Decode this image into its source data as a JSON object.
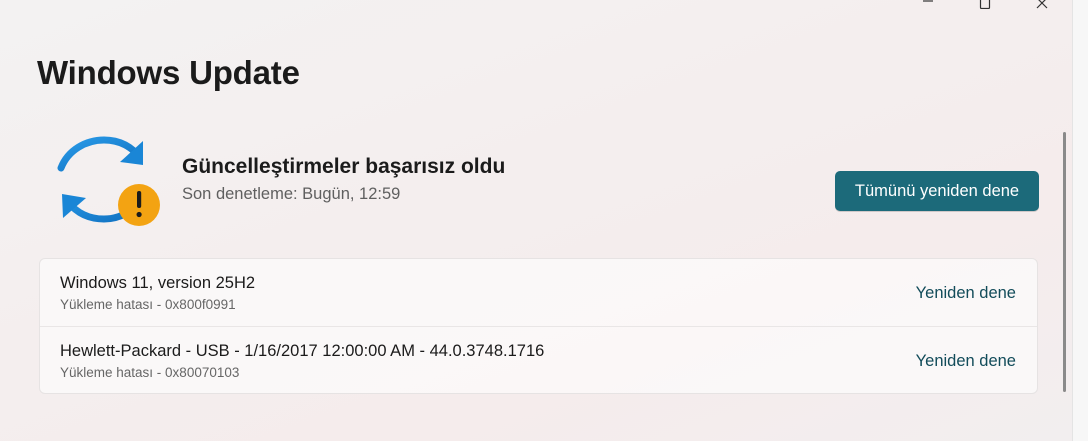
{
  "window": {
    "title": "Windows Update",
    "controls": {
      "minimize_icon": "minimize-icon",
      "maximize_icon": "maximize-icon",
      "close_icon": "close-icon"
    }
  },
  "status": {
    "icon": "sync-warning-icon",
    "heading": "Güncelleştirmeler başarısız oldu",
    "last_checked": "Son denetleme: Bugün, 12:59",
    "retry_all_label": "Tümünü yeniden dene"
  },
  "updates": [
    {
      "name": "Windows 11, version 25H2",
      "error": "Yükleme hatası - 0x800f0991",
      "action": "Yeniden dene"
    },
    {
      "name": "Hewlett-Packard - USB - 1/16/2017 12:00:00 AM - 44.0.3748.1716",
      "error": "Yükleme hatası - 0x80070103",
      "action": "Yeniden dene"
    }
  ],
  "colors": {
    "accent": "#1c6a7a",
    "link": "#124c5a",
    "sync_blue": "#1a86d6",
    "warning_orange": "#f3a312"
  }
}
